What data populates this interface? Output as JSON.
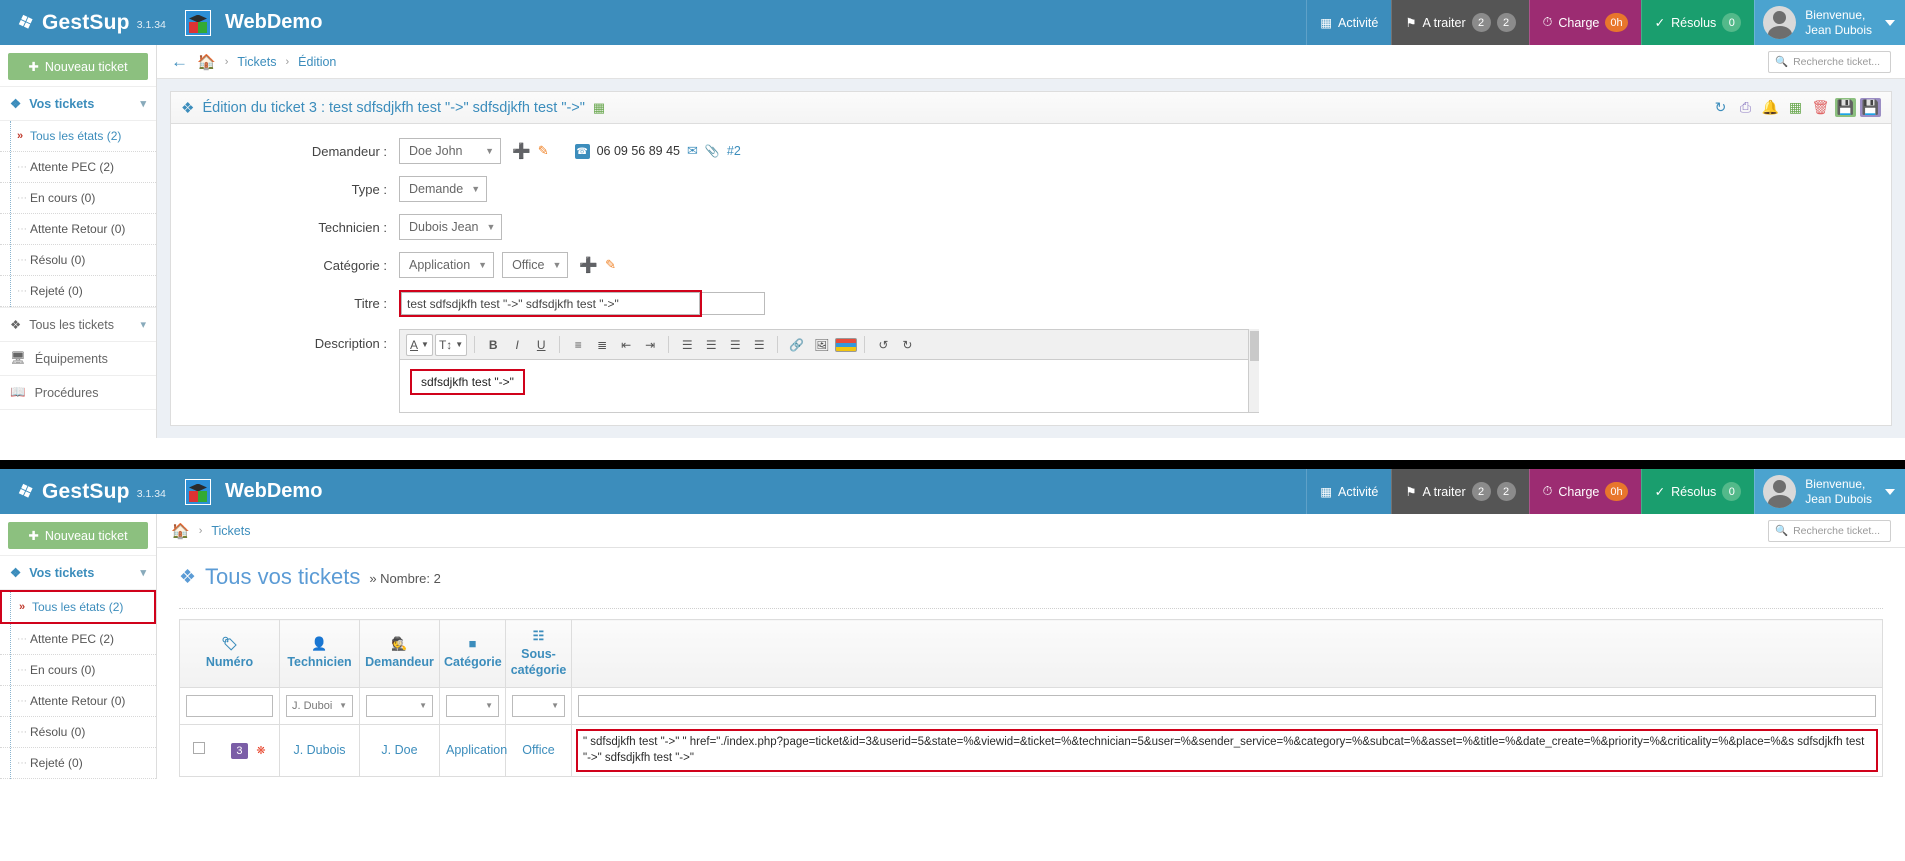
{
  "app": {
    "brand": "GestSup",
    "version": "3.1.34",
    "site_title": "WebDemo",
    "logo_icon": "feather-logo-icon",
    "cube_icon": "cube-logo-icon"
  },
  "topnav": {
    "activite": {
      "label": "Activité",
      "icon": "calendar-icon"
    },
    "traiter": {
      "label": "A traiter",
      "icon": "flag-icon",
      "badge1": "2",
      "badge2": "2"
    },
    "charge": {
      "label": "Charge",
      "icon": "gauge-icon",
      "badge": "0h"
    },
    "resolus": {
      "label": "Résolus",
      "icon": "check-circle-icon",
      "badge": "0"
    },
    "user": {
      "greeting": "Bienvenue,",
      "name": "Jean Dubois",
      "avatar_icon": "user-avatar-icon",
      "caret_icon": "chevron-down-icon"
    }
  },
  "sidebar": {
    "new_ticket": "Nouveau ticket",
    "new_ticket_icon": "plus-icon",
    "section_your_tickets": "Vos tickets",
    "section_all_tickets": "Tous les tickets",
    "items": [
      {
        "label": "Tous les états (2)",
        "active": true
      },
      {
        "label": "Attente PEC (2)",
        "active": false
      },
      {
        "label": "En cours (0)",
        "active": false
      },
      {
        "label": "Attente Retour (0)",
        "active": false
      },
      {
        "label": "Résolu (0)",
        "active": false
      },
      {
        "label": "Rejeté (0)",
        "active": false
      }
    ],
    "equipements": "Équipements",
    "procedures": "Procédures"
  },
  "top_panel": {
    "breadcrumb": {
      "back_icon": "arrow-left-icon",
      "home_icon": "home-icon",
      "items": [
        "Tickets",
        "Édition"
      ],
      "sep": "›"
    },
    "search_placeholder": "Recherche ticket...",
    "search_icon": "search-icon",
    "card_title": "Édition du ticket 3 : test sdfsdjkfh test \"->\" sdfsdjkfh test \"->\"",
    "card_title_icon": "feather-icon",
    "card_title_calendar_icon": "calendar-green-icon",
    "tools": [
      {
        "name": "refresh-icon",
        "glyph": "⟳"
      },
      {
        "name": "print-icon",
        "glyph": "⎙"
      },
      {
        "name": "bell-icon",
        "glyph": "🔔"
      },
      {
        "name": "calendar-icon",
        "glyph": "▦"
      },
      {
        "name": "trash-icon",
        "glyph": "🗑"
      },
      {
        "name": "save-icon",
        "glyph": "💾"
      },
      {
        "name": "save-as-icon",
        "glyph": "💾"
      }
    ],
    "form": {
      "demandeur_label": "Demandeur :",
      "demandeur_value": "Doe John",
      "add_icon": "plus-circle-icon",
      "edit_icon": "pencil-icon",
      "phone": "06 09 56 89 45",
      "phone_icon": "phone-icon",
      "mail_icon": "envelope-icon",
      "clip_icon": "paperclip-icon",
      "ref": "#2",
      "type_label": "Type :",
      "type_value": "Demande",
      "technicien_label": "Technicien :",
      "technicien_value": "Dubois Jean",
      "categorie_label": "Catégorie :",
      "categorie_value": "Application",
      "souscategorie_value": "Office",
      "titre_label": "Titre :",
      "titre_value": "test sdfsdjkfh test \"->\"  sdfsdjkfh test \"->\"",
      "description_label": "Description :",
      "description_value": "sdfsdjkfh test \"->\""
    },
    "editor_toolbar": [
      {
        "name": "font-color-icon",
        "glyph": "A",
        "boxed": true
      },
      {
        "name": "font-size-icon",
        "glyph": "T↕",
        "boxed": true
      },
      {
        "name": "bold-icon",
        "glyph": "B"
      },
      {
        "name": "italic-icon",
        "glyph": "I"
      },
      {
        "name": "underline-icon",
        "glyph": "U"
      },
      {
        "name": "bullet-list-icon",
        "glyph": "☰"
      },
      {
        "name": "numbered-list-icon",
        "glyph": "≣"
      },
      {
        "name": "outdent-icon",
        "glyph": "⇤"
      },
      {
        "name": "indent-icon",
        "glyph": "⇥"
      },
      {
        "name": "align-left-icon",
        "glyph": "≡"
      },
      {
        "name": "align-center-icon",
        "glyph": "≡"
      },
      {
        "name": "align-right-icon",
        "glyph": "≡"
      },
      {
        "name": "align-justify-icon",
        "glyph": "≡"
      },
      {
        "name": "link-icon",
        "glyph": "🔗"
      },
      {
        "name": "image-icon",
        "glyph": "🖼"
      },
      {
        "name": "palette-icon",
        "glyph": "▤"
      },
      {
        "name": "undo-icon",
        "glyph": "↺"
      },
      {
        "name": "redo-icon",
        "glyph": "↻"
      }
    ]
  },
  "bottom_panel": {
    "breadcrumb": {
      "home_icon": "home-icon",
      "items": [
        "Tickets"
      ],
      "sep": "›"
    },
    "search_placeholder": "Recherche ticket...",
    "search_icon": "search-icon",
    "page_title": "Tous vos tickets",
    "page_title_icon": "feather-icon",
    "page_subtitle": "» Nombre: 2",
    "table": {
      "headers": [
        {
          "label": "Numéro",
          "icon": "tag-icon"
        },
        {
          "label": "Technicien",
          "icon": "user-icon"
        },
        {
          "label": "Demandeur",
          "icon": "person-icon"
        },
        {
          "label": "Catégorie",
          "icon": "square-icon"
        },
        {
          "label": "Sous-catégorie",
          "icon": "sitemap-icon"
        },
        {
          "label": "",
          "icon": ""
        }
      ],
      "filters": [
        {
          "type": "input",
          "value": ""
        },
        {
          "type": "select",
          "value": "J. Duboi"
        },
        {
          "type": "select",
          "value": ""
        },
        {
          "type": "select",
          "value": ""
        },
        {
          "type": "select",
          "value": ""
        },
        {
          "type": "input",
          "value": ""
        }
      ],
      "rows": [
        {
          "checkbox": false,
          "numero": "3",
          "priority_icon": "red-dot-icon",
          "technicien": "J. Dubois",
          "demandeur": "J. Doe",
          "categorie": "Application",
          "souscategorie": "Office",
          "injected_text": "\" sdfsdjkfh test \"->\" \" href=\"./index.php?page=ticket&id=3&userid=5&state=%&viewid=&ticket=%&technician=5&user=%&sender_service=%&category=%&subcat=%&asset=%&title=%&date_create=%&priority=%&criticality=%&place=%&s sdfsdjkfh test \"->\" sdfsdjkfh test \"->\""
        }
      ]
    }
  },
  "colors": {
    "header_blue": "#3c8dbc",
    "green": "#8cc07f",
    "purple": "#9c2c72",
    "teal": "#1a9e6e",
    "red_highlight": "#d0021b",
    "link_blue": "#3c8dbc"
  }
}
